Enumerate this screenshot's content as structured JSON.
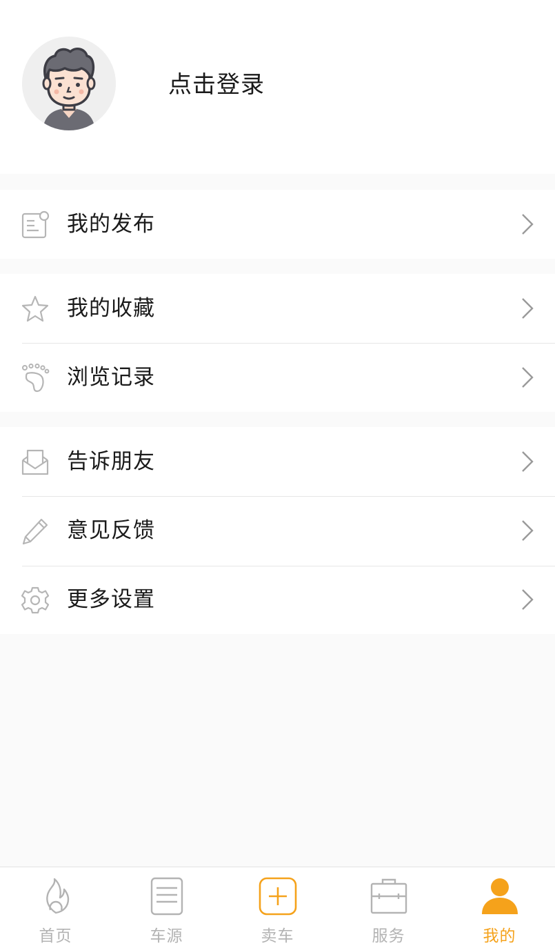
{
  "profile": {
    "login_label": "点击登录"
  },
  "menu": {
    "group1": [
      {
        "label": "我的发布",
        "icon": "document-icon"
      }
    ],
    "group2": [
      {
        "label": "我的收藏",
        "icon": "star-icon"
      },
      {
        "label": "浏览记录",
        "icon": "footprint-icon"
      }
    ],
    "group3": [
      {
        "label": "告诉朋友",
        "icon": "envelope-icon"
      },
      {
        "label": "意见反馈",
        "icon": "pencil-icon"
      },
      {
        "label": "更多设置",
        "icon": "gear-icon"
      }
    ]
  },
  "tabbar": {
    "items": [
      {
        "label": "首页",
        "icon": "flame-icon",
        "active": false
      },
      {
        "label": "车源",
        "icon": "list-icon",
        "active": false
      },
      {
        "label": "卖车",
        "icon": "plus-square-icon",
        "active": false
      },
      {
        "label": "服务",
        "icon": "briefcase-icon",
        "active": false
      },
      {
        "label": "我的",
        "icon": "person-icon",
        "active": true
      }
    ]
  },
  "colors": {
    "accent": "#f5a21b",
    "tab_inactive": "#b3b3b3",
    "icon_gray": "#b5b5b5",
    "section_gap": "#f4f4f4"
  }
}
